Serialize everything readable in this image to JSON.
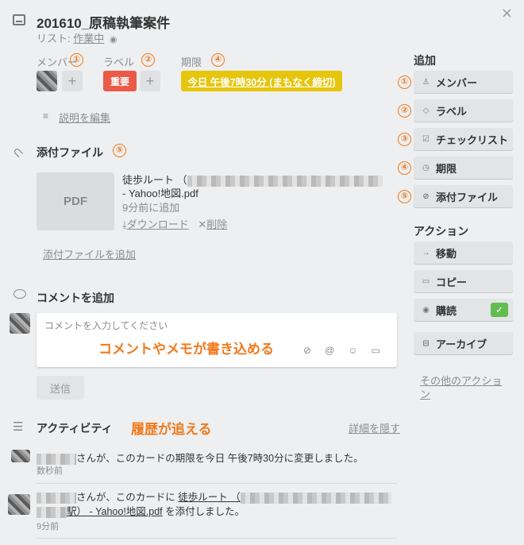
{
  "card": {
    "title": "201610_原稿執筆案件",
    "list_prefix": "リスト: ",
    "list_name": "作業中"
  },
  "fields": {
    "members_label": "メンバー",
    "labels_label": "ラベル",
    "due_label": "期限",
    "label_tag": "重要",
    "label_color": "#eb5a46",
    "due_badge": "今日 午後7時30分 (まもなく締切)",
    "due_color": "#e6c60d",
    "edit_description": "説明を編集"
  },
  "attachments": {
    "heading": "添付ファイル",
    "file_thumb": "PDF",
    "file_name_prefix": "徒歩ルート （",
    "file_name_suffix": "- Yahoo!地図.pdf",
    "added": "9分前に追加",
    "download": "ダウンロード",
    "delete": "削除",
    "add_link": "添付ファイルを追加"
  },
  "comment": {
    "heading": "コメントを追加",
    "placeholder": "コメントを入力してください",
    "annotation": "コメントやメモが書き込める",
    "send": "送信"
  },
  "activity": {
    "heading": "アクティビティ",
    "annotation": "履歴が追える",
    "hide_details": "詳細を隠す",
    "items": [
      {
        "text": "さんが、このカードの期限を今日 午後7時30分に変更しました。",
        "time": "数秒前"
      },
      {
        "text_a": "さんが、このカードに ",
        "link_a": "徒歩ルート （",
        "link_b": "駅） - Yahoo!地図.pdf",
        "text_b": " を添付しました。",
        "time": "9分前"
      }
    ]
  },
  "sidebar": {
    "add_heading": "追加",
    "add_buttons": [
      {
        "num": "①",
        "label": "メンバー",
        "icon": "person-icon"
      },
      {
        "num": "②",
        "label": "ラベル",
        "icon": "tag-icon"
      },
      {
        "num": "③",
        "label": "チェックリスト",
        "icon": "checkbox-icon"
      },
      {
        "num": "④",
        "label": "期限",
        "icon": "clock-icon"
      },
      {
        "num": "⑤",
        "label": "添付ファイル",
        "icon": "paperclip-icon"
      }
    ],
    "actions_heading": "アクション",
    "actions": [
      {
        "label": "移動",
        "icon": "arrow-right-icon"
      },
      {
        "label": "コピー",
        "icon": "card-icon"
      },
      {
        "label": "購読",
        "icon": "eye-icon"
      },
      {
        "label": "アーカイブ",
        "icon": "archive-icon"
      }
    ],
    "more_actions": "その他のアクション",
    "check": "✓"
  },
  "numbers": {
    "n1": "①",
    "n2": "②",
    "n4": "④",
    "n5": "⑤"
  },
  "close": "×"
}
